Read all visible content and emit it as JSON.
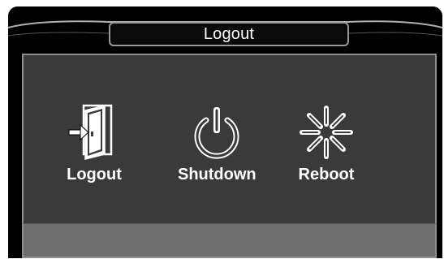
{
  "dialog": {
    "title": "Logout"
  },
  "actions": [
    {
      "id": "logout",
      "label": "Logout",
      "icon": "door-exit-icon"
    },
    {
      "id": "shutdown",
      "label": "Shutdown",
      "icon": "power-icon"
    },
    {
      "id": "reboot",
      "label": "Reboot",
      "icon": "burst-icon"
    }
  ],
  "colors": {
    "window_bg": "#000000",
    "panel_bg": "#3a3a3a",
    "footer_bg": "#6f6f6f",
    "border": "#8e8e8e",
    "text": "#ffffff"
  }
}
